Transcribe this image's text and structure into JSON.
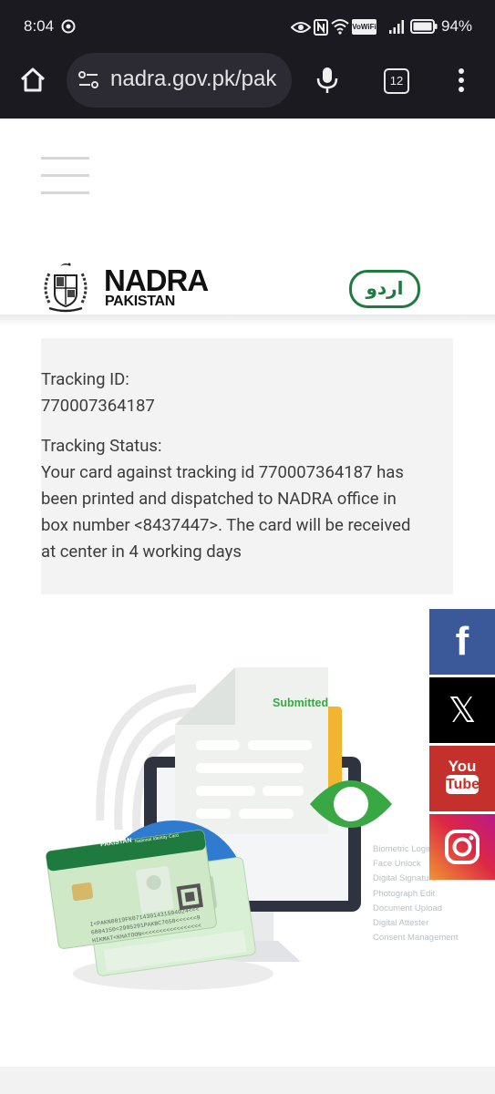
{
  "status_bar": {
    "time": "8:04",
    "battery": "94%",
    "wifi_label": "VoWiFi"
  },
  "browser": {
    "url": "nadra.gov.pk/pak",
    "tab_count": "12"
  },
  "header": {
    "brand_title": "NADRA",
    "brand_subtitle": "PAKISTAN",
    "language_button": "اردو"
  },
  "tracking": {
    "id_label": "Tracking ID:",
    "id_value": "770007364187",
    "status_label": "Tracking Status:",
    "status_lines": [
      "Your card against tracking id 770007364187 has",
      "been printed and dispatched to NADRA office in",
      "box number <8437447>. The card will be received",
      "at center in 4 working days"
    ]
  },
  "illustration": {
    "document_badge": "Submitted",
    "features": [
      "Biometric Login",
      "Face Unlock",
      "Digital Signature",
      "Photograph Edit",
      "Document Upload",
      "Digital Attester",
      "Consent Management"
    ],
    "card_country": "PAKISTAN",
    "card_title": "National Identity Card",
    "card_mrz": [
      "I<PAKN0019FK0714301431594024<<<",
      "6804150<2905291PAKBC7650<<<<<<9",
      "HIKMAT<KHATOON<<<<<<<<<<<<<<<<<"
    ]
  },
  "social": {
    "facebook_glyph": "f",
    "x_glyph": "𝕏",
    "youtube_top": "You",
    "youtube_bottom": "Tube"
  },
  "colors": {
    "nadra_green": "#1e7a3e",
    "facebook": "#3b5998",
    "youtube": "#c4302b",
    "eye_green": "#39a844"
  }
}
